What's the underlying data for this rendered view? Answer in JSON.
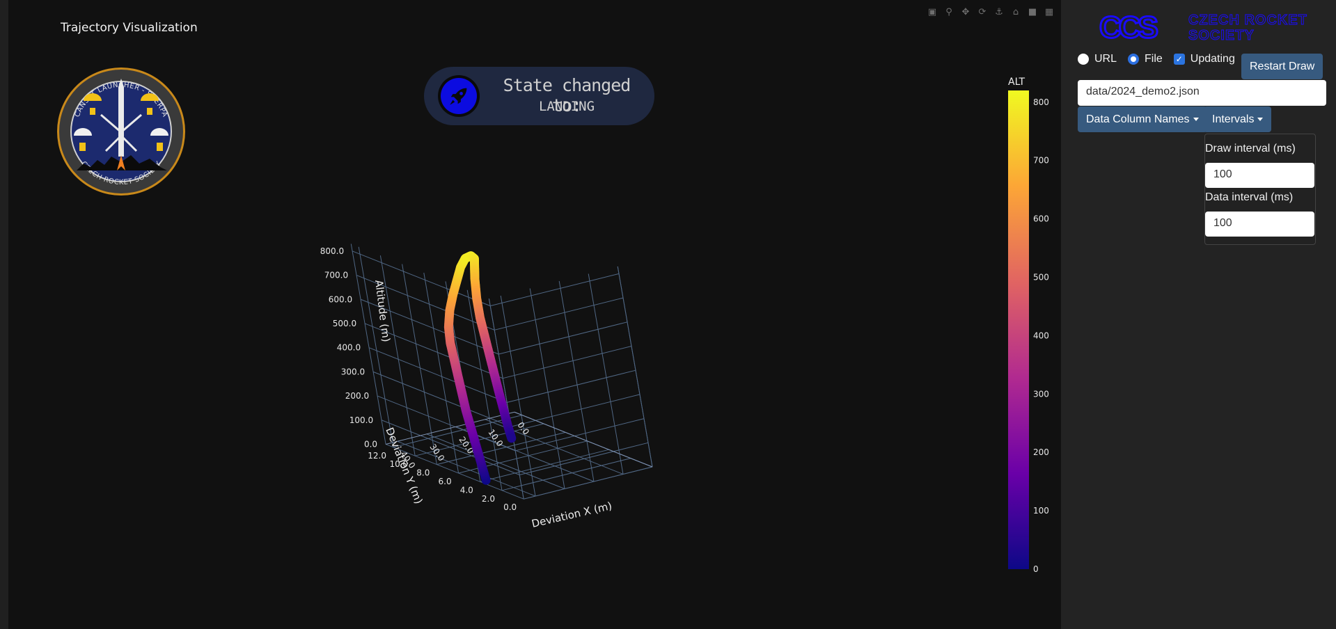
{
  "plot": {
    "title": "Trajectory Visualization",
    "modebar": [
      "camera-icon",
      "zoom-icon",
      "pan-icon",
      "orbit-icon",
      "turntable-icon",
      "home-icon",
      "camera-view-icon",
      "plotly-logo-icon"
    ]
  },
  "mission_badge": {
    "top_text": "CANSAT LAUNCHER - SHERPA",
    "bottom_text": "CZECH ROCKET SOCIETY"
  },
  "state_card": {
    "title": "State changed to:",
    "value": "LANDING",
    "icon": "rocket-icon"
  },
  "chart_data": {
    "type": "scatter3d",
    "x_axis": {
      "title": "Deviation X (m)",
      "ticks": [
        "0.0",
        "10.0",
        "20.0",
        "30.0",
        "40.0"
      ]
    },
    "y_axis": {
      "title": "Deviation Y (m)",
      "ticks": [
        "0.0",
        "2.0",
        "4.0",
        "6.0",
        "8.0",
        "10.0",
        "12.0"
      ]
    },
    "z_axis": {
      "title": "Altitude (m)",
      "ticks": [
        "0.0",
        "100.0",
        "200.0",
        "300.0",
        "400.0",
        "500.0",
        "600.0",
        "700.0",
        "800.0"
      ]
    },
    "colorbar": {
      "title": "ALT",
      "ticks": [
        "0",
        "100",
        "200",
        "300",
        "400",
        "500",
        "600",
        "700",
        "800"
      ],
      "range": [
        0,
        820
      ],
      "colorscale": "plasma"
    },
    "trajectory": {
      "x": [
        42,
        41,
        40,
        39,
        38,
        37,
        36,
        35,
        34,
        33,
        31,
        29,
        27,
        25,
        23,
        21,
        20,
        20.5,
        21,
        21.5,
        21.5,
        21,
        20.5,
        20,
        19.5,
        19,
        18.5,
        18
      ],
      "y": [
        4,
        4.5,
        5,
        5.5,
        6,
        6.4,
        6.8,
        7.2,
        7.6,
        7.8,
        8,
        8,
        8,
        8,
        8,
        8,
        8,
        8,
        8,
        8,
        8,
        8,
        8,
        8,
        8,
        8,
        8,
        8
      ],
      "z": [
        0,
        60,
        120,
        180,
        240,
        300,
        360,
        420,
        480,
        540,
        600,
        660,
        710,
        760,
        790,
        795,
        780,
        740,
        700,
        620,
        540,
        460,
        380,
        300,
        220,
        150,
        80,
        30
      ]
    }
  },
  "sidebar": {
    "logo_letters": "CCS",
    "logo_text_line1": "CZECH ROCKET",
    "logo_text_line2": "SOCIETY",
    "source_url_label": "URL",
    "source_file_label": "File",
    "updating_label": "Updating",
    "restart_button": "Restart Draw",
    "file_path": "data/2024_demo2.json",
    "data_columns_button": "Data Column Names",
    "intervals_button": "Intervals",
    "intervals_menu": {
      "draw_label": "Draw interval (ms)",
      "draw_value": "100",
      "data_label": "Data interval (ms)",
      "data_value": "100"
    }
  },
  "colors": {
    "accent": "#375a7f",
    "logo_blue": "#1a0bff",
    "badge_navy": "#1c2a6e"
  }
}
